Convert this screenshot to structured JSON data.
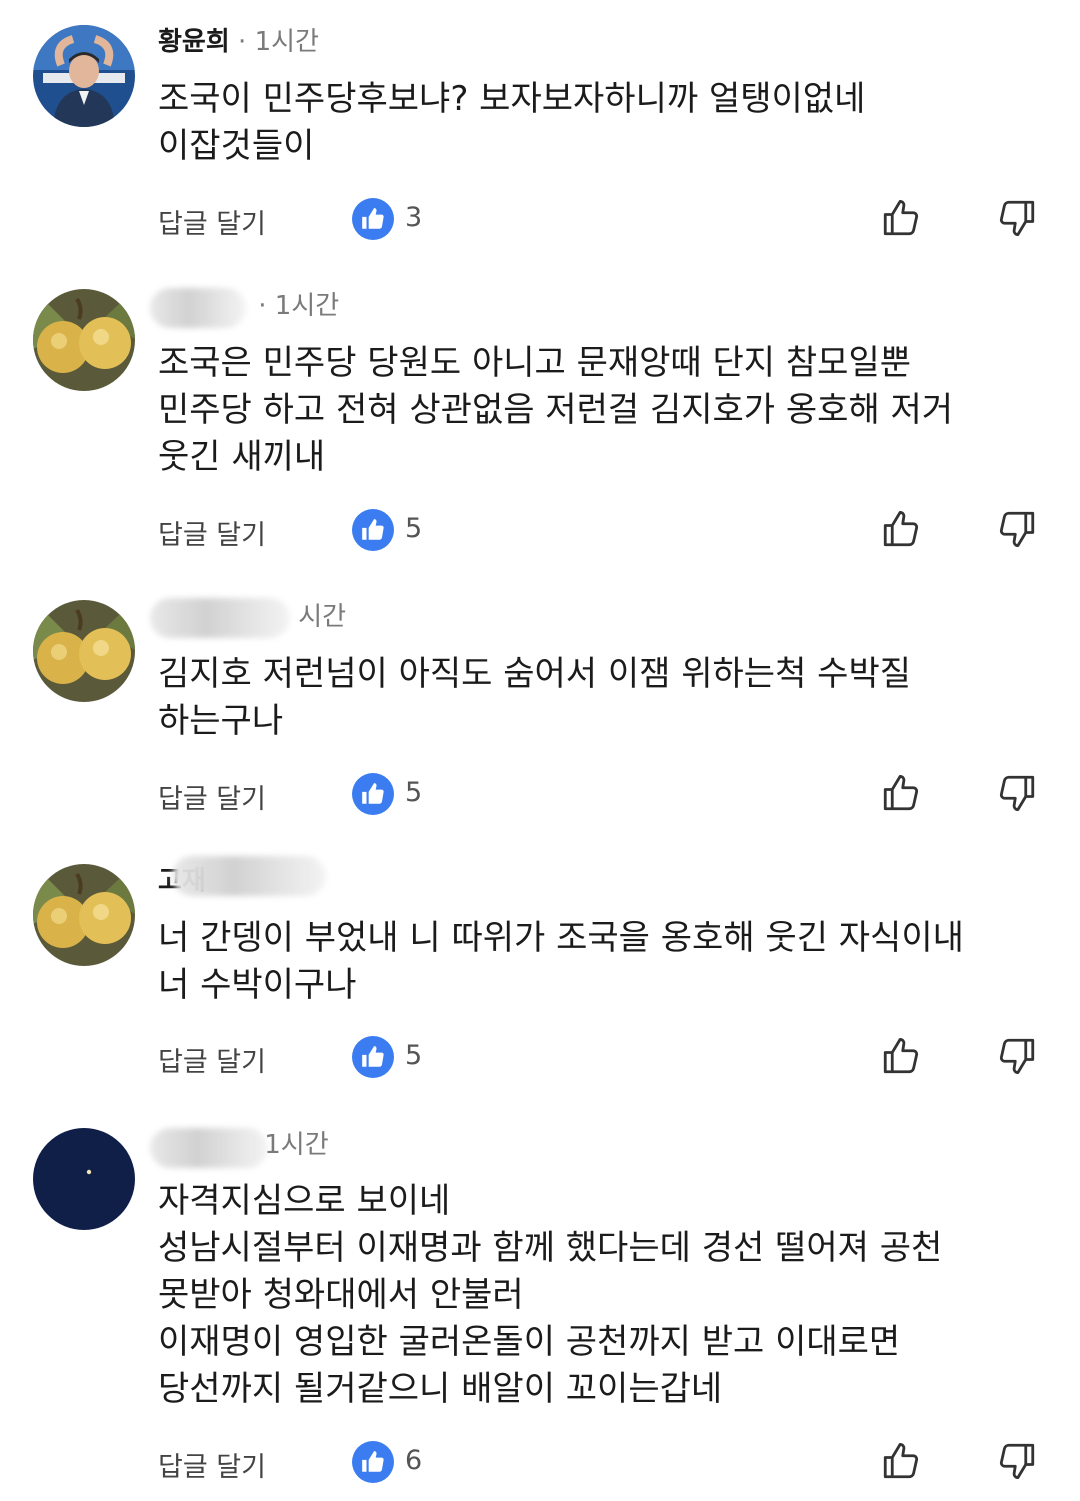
{
  "ui": {
    "reply_label": "답글 달기",
    "meta_separator": "·",
    "colors": {
      "like_badge": "#3b7cf0",
      "text": "#1b1b1b",
      "meta": "#7a7a7a",
      "actions": "#444444"
    }
  },
  "comments": [
    {
      "author": "황윤희",
      "time": "1시간",
      "lines": [
        "조국이 민주당후보냐?  보자보자하니까 얼탱이없네",
        "이잡것들이"
      ],
      "likes": "3",
      "avatar": "person-photo"
    },
    {
      "author": "",
      "time": "1시간",
      "lines": [
        "조국은 민주당 당원도 아니고 문재앙때 단지 참모일뿐",
        "민주당 하고 전혀 상관없음 저런걸 김지호가 옹호해 저거",
        "웃긴 새끼내"
      ],
      "likes": "5",
      "avatar": "fruit-photo"
    },
    {
      "author": "",
      "time": "시간",
      "lines": [
        "김지호  저런넘이  아직도 숨어서  이잼 위하는척 수박질",
        "하는구나"
      ],
      "likes": "5",
      "avatar": "fruit-photo"
    },
    {
      "author": "고재",
      "time": "",
      "lines": [
        "너 간뎅이 부었내 니 따위가 조국을 옹호해  웃긴 자식이내",
        "너 수박이구나"
      ],
      "likes": "5",
      "avatar": "fruit-photo"
    },
    {
      "author": "",
      "time": "1시간",
      "lines": [
        "자격지심으로 보이네",
        "성남시절부터 이재명과 함께 했다는데 경선 떨어져 공천",
        "못받아 청와대에서 안불러",
        "이재명이 영입한 굴러온돌이 공천까지 받고 이대로면",
        "당선까지 될거같으니 배알이 꼬이는갑네"
      ],
      "likes": "6",
      "avatar": "night-sky-photo"
    }
  ]
}
